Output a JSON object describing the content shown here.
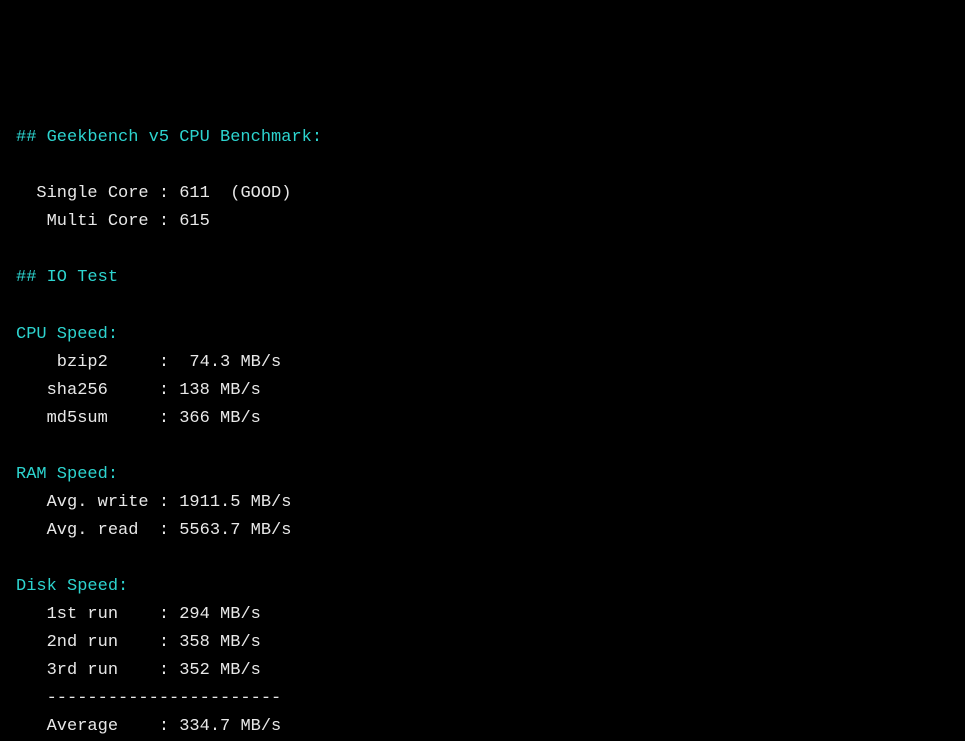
{
  "header_geekbench": "## Geekbench v5 CPU Benchmark:",
  "geekbench": {
    "single_label": "  Single Core :",
    "single_value": " 611  (GOOD)",
    "multi_label": "   Multi Core :",
    "multi_value": " 615"
  },
  "header_io": "## IO Test",
  "cpu_speed": {
    "title": "CPU Speed:",
    "bzip2_label": "    bzip2     :",
    "bzip2_value": "  74.3 MB/s",
    "sha256_label": "   sha256     :",
    "sha256_value": " 138 MB/s",
    "md5sum_label": "   md5sum     :",
    "md5sum_value": " 366 MB/s"
  },
  "ram_speed": {
    "title": "RAM Speed:",
    "write_label": "   Avg. write :",
    "write_value": " 1911.5 MB/s",
    "read_label": "   Avg. read  :",
    "read_value": " 5563.7 MB/s"
  },
  "disk_speed": {
    "title": "Disk Speed:",
    "run1_label": "   1st run    :",
    "run1_value": " 294 MB/s",
    "run2_label": "   2nd run    :",
    "run2_value": " 358 MB/s",
    "run3_label": "   3rd run    :",
    "run3_value": " 352 MB/s",
    "divider": "   -----------------------",
    "avg_label": "   Average    :",
    "avg_value": " 334.7 MB/s"
  }
}
